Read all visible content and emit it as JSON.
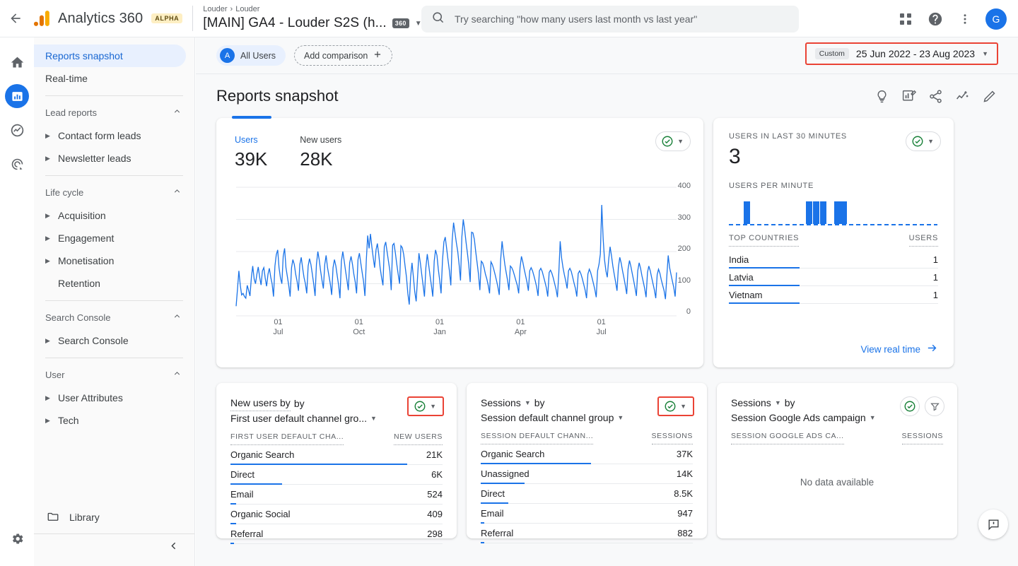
{
  "topbar": {
    "back_icon": "arrow-back-icon",
    "brand_name": "Analytics 360",
    "alpha_badge": "ALPHA",
    "breadcrumb_account": "Louder",
    "breadcrumb_property": "Louder",
    "property_title": "[MAIN] GA4 - Louder S2S (h...",
    "badge_360": "360",
    "search_placeholder": "Try searching \"how many users last month vs last year\"",
    "avatar_initial": "G"
  },
  "rail": {
    "items": [
      {
        "name": "home-icon",
        "label": "Home",
        "active": false
      },
      {
        "name": "reports-icon",
        "label": "Reports",
        "active": true
      },
      {
        "name": "explore-icon",
        "label": "Explore",
        "active": false
      },
      {
        "name": "advertising-icon",
        "label": "Advertising",
        "active": false
      }
    ],
    "settings_label": "Admin"
  },
  "sidebar": {
    "top_items": [
      {
        "label": "Reports snapshot",
        "selected": true
      },
      {
        "label": "Real-time",
        "selected": false
      }
    ],
    "sections": [
      {
        "title": "Lead reports",
        "items": [
          {
            "label": "Contact form leads",
            "expandable": true
          },
          {
            "label": "Newsletter leads",
            "expandable": true
          }
        ]
      },
      {
        "title": "Life cycle",
        "items": [
          {
            "label": "Acquisition",
            "expandable": true
          },
          {
            "label": "Engagement",
            "expandable": true
          },
          {
            "label": "Monetisation",
            "expandable": true
          },
          {
            "label": "Retention",
            "expandable": false
          }
        ]
      },
      {
        "title": "Search Console",
        "items": [
          {
            "label": "Search Console",
            "expandable": true
          }
        ]
      },
      {
        "title": "User",
        "items": [
          {
            "label": "User Attributes",
            "expandable": true
          },
          {
            "label": "Tech",
            "expandable": true
          }
        ]
      }
    ],
    "library_label": "Library",
    "collapse_icon": "chevron-left-icon"
  },
  "comparison": {
    "all_users_label": "All Users",
    "all_users_initial": "A",
    "add_comparison_label": "Add comparison"
  },
  "daterange": {
    "custom_tag": "Custom",
    "range": "25 Jun 2022 - 23 Aug 2023",
    "highlight_color": "#ea4335"
  },
  "page": {
    "title": "Reports snapshot",
    "head_icons": [
      "insights-lightbulb-icon",
      "customise-report-icon",
      "share-icon",
      "trend-analysis-icon",
      "edit-pencil-icon"
    ]
  },
  "users_card": {
    "metrics": [
      {
        "label": "Users",
        "value": "39K",
        "selected": true
      },
      {
        "label": "New users",
        "value": "28K",
        "selected": false
      }
    ],
    "status_icon": "data-ok-check-icon",
    "status_caret": "chevron-down-icon"
  },
  "realtime_card": {
    "label": "USERS IN LAST 30 MINUTES",
    "value": "3",
    "per_minute_label": "USERS PER MINUTE",
    "table_header_dim": "TOP COUNTRIES",
    "table_header_metric": "USERS",
    "rows": [
      {
        "name": "India",
        "value": "1",
        "bar": 100
      },
      {
        "name": "Latvia",
        "value": "1",
        "bar": 100
      },
      {
        "name": "Vietnam",
        "value": "1",
        "bar": 100
      }
    ],
    "view_link": "View real time",
    "status_icon": "data-ok-check-icon"
  },
  "bottom_cards": [
    {
      "title_line1": "New users by",
      "title_line2": "First user default channel gro...",
      "header_dim": "FIRST USER DEFAULT CHA...",
      "header_metric": "NEW USERS",
      "metric_dropdown": false,
      "pill_framed": true,
      "rows": [
        {
          "name": "Organic Search",
          "value": "21K",
          "bar": 96
        },
        {
          "name": "Direct",
          "value": "6K",
          "bar": 28
        },
        {
          "name": "Email",
          "value": "524",
          "bar": 3
        },
        {
          "name": "Organic Social",
          "value": "409",
          "bar": 3
        },
        {
          "name": "Referral",
          "value": "298",
          "bar": 2
        }
      ],
      "no_data": null
    },
    {
      "title_line1": "Sessions",
      "title_line2": "Session default channel group",
      "header_dim": "SESSION DEFAULT CHANN...",
      "header_metric": "SESSIONS",
      "metric_dropdown": true,
      "pill_framed": true,
      "rows": [
        {
          "name": "Organic Search",
          "value": "37K",
          "bar": 60
        },
        {
          "name": "Unassigned",
          "value": "14K",
          "bar": 24
        },
        {
          "name": "Direct",
          "value": "8.5K",
          "bar": 15
        },
        {
          "name": "Email",
          "value": "947",
          "bar": 2
        },
        {
          "name": "Referral",
          "value": "882",
          "bar": 2
        }
      ],
      "no_data": null
    },
    {
      "title_line1": "Sessions",
      "title_line2": "Session Google Ads campaign",
      "header_dim": "SESSION GOOGLE ADS CA...",
      "header_metric": "SESSIONS",
      "metric_dropdown": true,
      "pill_framed": false,
      "filter_icon": "filter-funnel-icon",
      "rows": [],
      "no_data": "No data available"
    }
  ],
  "feedback": {
    "icon": "feedback-icon"
  },
  "chart_data": {
    "type": "line",
    "title": "Users over time",
    "xlabel": "",
    "ylabel": "Users",
    "ylim": [
      0,
      400
    ],
    "yticks": [
      400,
      300,
      200,
      100,
      0
    ],
    "xticks": [
      {
        "day": "01",
        "month": "Jul"
      },
      {
        "day": "01",
        "month": "Oct"
      },
      {
        "day": "01",
        "month": "Jan"
      },
      {
        "day": "01",
        "month": "Apr"
      },
      {
        "day": "01",
        "month": "Jul"
      }
    ],
    "series": [
      {
        "name": "Users",
        "color": "#1a73e8",
        "values": [
          30,
          85,
          140,
          95,
          65,
          70,
          60,
          55,
          95,
          80,
          62,
          120,
          155,
          115,
          100,
          130,
          152,
          120,
          96,
          140,
          150,
          118,
          92,
          130,
          148,
          120,
          100,
          60,
          155,
          190,
          205,
          150,
          118,
          100,
          185,
          210,
          150,
          122,
          95,
          60,
          150,
          175,
          160,
          130,
          108,
          78,
          160,
          182,
          150,
          120,
          100,
          70,
          155,
          178,
          160,
          130,
          100,
          62,
          160,
          200,
          175,
          140,
          110,
          85,
          160,
          188,
          150,
          125,
          100,
          65,
          150,
          175,
          155,
          125,
          95,
          55,
          170,
          200,
          172,
          140,
          112,
          80,
          165,
          185,
          160,
          130,
          105,
          70,
          175,
          195,
          165,
          135,
          108,
          62,
          175,
          250,
          210,
          255,
          215,
          180,
          150,
          205,
          225,
          190,
          150,
          120,
          95,
          215,
          230,
          200,
          170,
          140,
          80,
          220,
          225,
          195,
          160,
          130,
          100,
          218,
          212,
          190,
          155,
          120,
          70,
          35,
          120,
          165,
          120,
          75,
          45,
          118,
          195,
          165,
          130,
          95,
          60,
          150,
          192,
          160,
          125,
          95,
          60,
          170,
          205,
          188,
          145,
          110,
          70,
          172,
          230,
          245,
          210,
          175,
          140,
          95,
          235,
          290,
          260,
          228,
          200,
          160,
          110,
          245,
          300,
          268,
          230,
          195,
          158,
          105,
          260,
          258,
          238,
          200,
          165,
          130,
          80,
          170,
          165,
          150,
          130,
          115,
          95,
          70,
          168,
          160,
          145,
          128,
          110,
          90,
          65,
          175,
          232,
          195,
          160,
          135,
          110,
          80,
          155,
          150,
          140,
          125,
          110,
          95,
          70,
          150,
          185,
          168,
          145,
          125,
          105,
          78,
          140,
          150,
          140,
          125,
          108,
          90,
          62,
          140,
          148,
          138,
          122,
          105,
          88,
          60,
          135,
          142,
          132,
          118,
          100,
          82,
          58,
          135,
          232,
          180,
          150,
          128,
          108,
          85,
          140,
          148,
          138,
          120,
          102,
          85,
          60,
          132,
          140,
          130,
          115,
          98,
          80,
          55,
          130,
          145,
          135,
          118,
          100,
          82,
          58,
          140,
          160,
          192,
          345,
          240,
          175,
          140,
          120,
          175,
          215,
          188,
          155,
          130,
          105,
          78,
          150,
          182,
          165,
          140,
          118,
          95,
          68,
          145,
          172,
          155,
          132,
          110,
          88,
          62,
          140,
          165,
          148,
          125,
          105,
          85,
          58,
          135,
          155,
          140,
          120,
          100,
          80,
          55,
          128,
          145,
          132,
          112,
          95,
          78,
          52,
          125,
          188,
          150,
          128,
          108,
          88,
          60,
          135
        ]
      }
    ]
  },
  "realtime_chart": {
    "type": "bar",
    "minutes": 30,
    "values": [
      0,
      0,
      1,
      0,
      0,
      0,
      0,
      0,
      0,
      0,
      0,
      1,
      1,
      1,
      0,
      1,
      1,
      0,
      0,
      0,
      0,
      0,
      0,
      0,
      0,
      0,
      0,
      0,
      0,
      0
    ]
  }
}
